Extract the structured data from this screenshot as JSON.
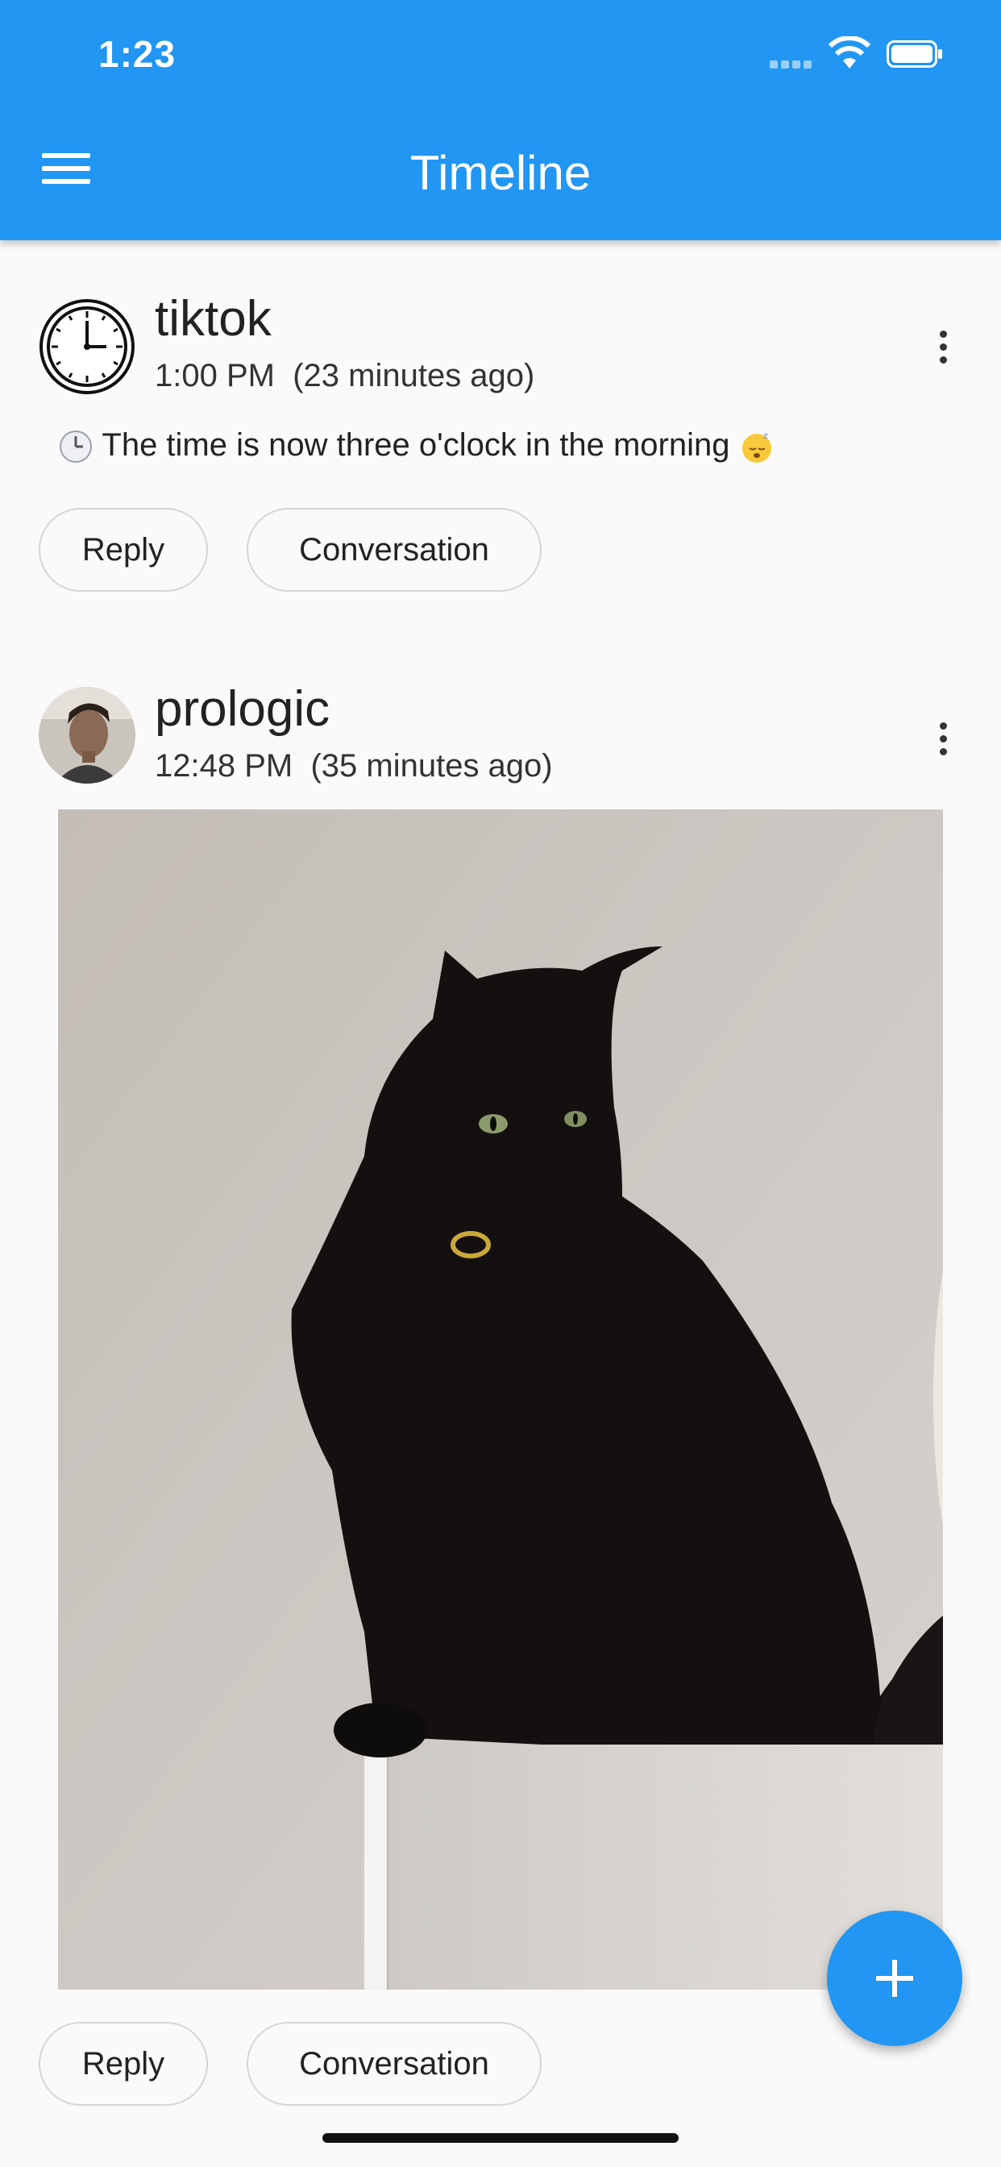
{
  "status_bar": {
    "time": "1:23"
  },
  "app_bar": {
    "title": "Timeline"
  },
  "posts": [
    {
      "author": "tiktok",
      "time": "1:00 PM",
      "relative": "(23 minutes ago)",
      "text": "The time is now three o'clock in the morning",
      "reply_label": "Reply",
      "conversation_label": "Conversation"
    },
    {
      "author": "prologic",
      "time": "12:48 PM",
      "relative": "(35 minutes ago)",
      "reply_label": "Reply",
      "conversation_label": "Conversation"
    }
  ],
  "colors": {
    "primary": "#2196f3",
    "background": "#fafafa"
  }
}
